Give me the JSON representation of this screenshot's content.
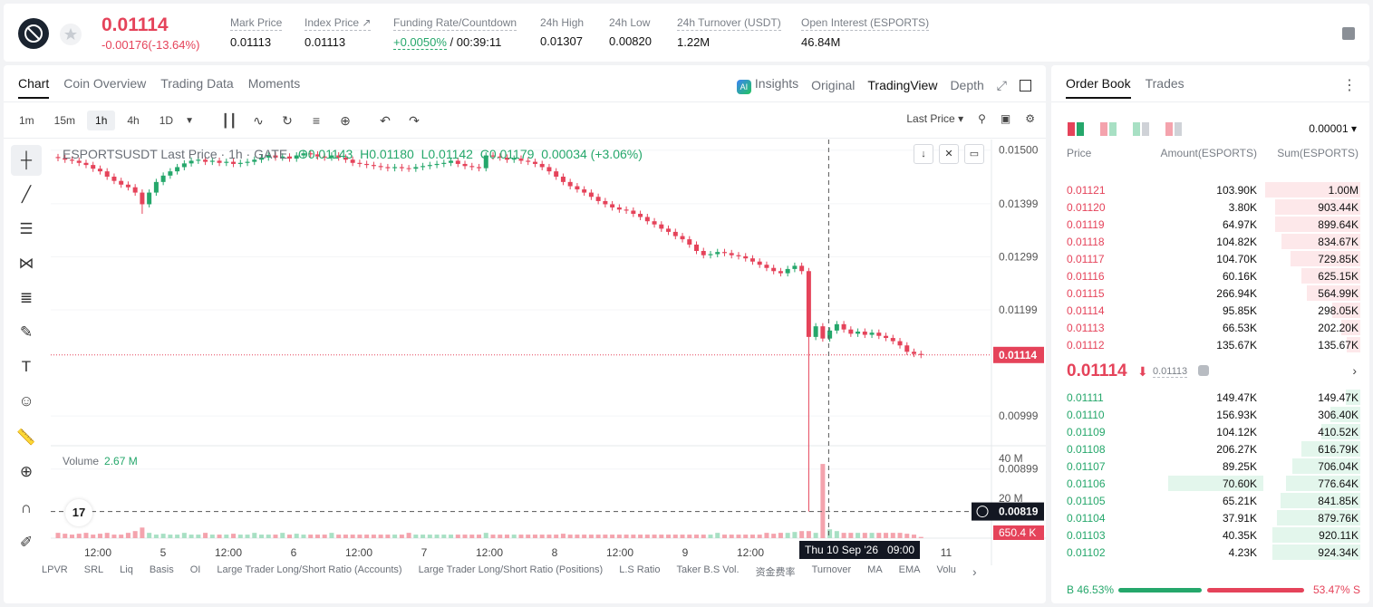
{
  "ticker": {
    "last_price": "0.01114",
    "change": "-0.00176(-13.64%)",
    "stats": [
      {
        "label": "Mark Price",
        "value": "0.01113"
      },
      {
        "label": "Index Price ↗",
        "value": "0.01113"
      },
      {
        "label": "Funding Rate/Countdown",
        "value_pos": "+0.0050%",
        "value": " / 00:39:11"
      },
      {
        "label": "24h High",
        "value": "0.01307"
      },
      {
        "label": "24h Low",
        "value": "0.00820"
      },
      {
        "label": "24h Turnover (USDT)",
        "value": "1.22M"
      },
      {
        "label": "Open Interest (ESPORTS)",
        "value": "46.84M"
      }
    ]
  },
  "chart_tabs": [
    "Chart",
    "Coin Overview",
    "Trading Data",
    "Moments"
  ],
  "view_switch": {
    "insights": "Insights",
    "original": "Original",
    "tradingview": "TradingView",
    "depth": "Depth"
  },
  "intervals": [
    "1m",
    "15m",
    "1h",
    "4h",
    "1D"
  ],
  "price_type": "Last Price",
  "legend": {
    "symbol": "ESPORTSUSDT Last Price · 1h · GATE",
    "o": "O0.01143",
    "h": "H0.01180",
    "l": "L0.01142",
    "c": "C0.01179",
    "chg": "0.00034 (+3.06%)"
  },
  "volume": {
    "label": "Volume",
    "value": "2.67 M"
  },
  "crosshair": {
    "date": "Thu 10 Sep '26",
    "time": "09:00"
  },
  "indicators": [
    "LPVR",
    "SRL",
    "Liq",
    "Basis",
    "OI",
    "Large Trader Long/Short Ratio (Accounts)",
    "Large Trader Long/Short Ratio (Positions)",
    "L.S Ratio",
    "Taker B.S Vol.",
    "资金费率",
    "Turnover",
    "MA",
    "EMA",
    "Volu"
  ],
  "chart_data": {
    "type": "candlestick",
    "y_ticks": [
      "0.01500",
      "0.01399",
      "0.01299",
      "0.01199",
      "0.00999",
      "0.00899"
    ],
    "ylim": [
      0.0082,
      0.0152
    ],
    "current_price": "0.01114",
    "low_marker": "0.00819",
    "volume_ticks": [
      "40 M",
      "20 M"
    ],
    "volume_current": "650.4 K",
    "x_ticks": [
      "12:00",
      "5",
      "12:00",
      "6",
      "12:00",
      "7",
      "12:00",
      "8",
      "12:00",
      "9",
      "12:00",
      "11"
    ],
    "closes": [
      0.01485,
      0.01482,
      0.0148,
      0.01476,
      0.01472,
      0.01465,
      0.0146,
      0.0145,
      0.01442,
      0.01435,
      0.0143,
      0.0142,
      0.01398,
      0.0142,
      0.0144,
      0.01452,
      0.0146,
      0.01468,
      0.01475,
      0.0148,
      0.01482,
      0.01478,
      0.0148,
      0.01476,
      0.01478,
      0.01474,
      0.01476,
      0.01478,
      0.01482,
      0.01486,
      0.0149,
      0.01486,
      0.01488,
      0.01484,
      0.0149,
      0.01494,
      0.01492,
      0.01488,
      0.01486,
      0.0149,
      0.01486,
      0.01482,
      0.01476,
      0.01474,
      0.01472,
      0.0147,
      0.01468,
      0.01466,
      0.01468,
      0.01466,
      0.01465,
      0.01468,
      0.0147,
      0.01472,
      0.01474,
      0.01476,
      0.0148,
      0.01474,
      0.0147,
      0.01468,
      0.01466,
      0.0149,
      0.01488,
      0.01486,
      0.01482,
      0.01484,
      0.0148,
      0.01478,
      0.01474,
      0.01468,
      0.0146,
      0.0145,
      0.0144,
      0.01432,
      0.01426,
      0.0142,
      0.01412,
      0.01404,
      0.01398,
      0.01392,
      0.01388,
      0.01386,
      0.0138,
      0.01374,
      0.01366,
      0.0136,
      0.01352,
      0.01346,
      0.01338,
      0.01332,
      0.01322,
      0.0131,
      0.01302,
      0.01304,
      0.01308,
      0.01306,
      0.01302,
      0.013,
      0.01296,
      0.0129,
      0.01284,
      0.01278,
      0.01272,
      0.01268,
      0.01276,
      0.01282,
      0.01272,
      0.01148,
      0.01168,
      0.01145,
      0.0116,
      0.01172,
      0.01162,
      0.01154,
      0.01158,
      0.01152,
      0.01156,
      0.0115,
      0.01146,
      0.0114,
      0.01132,
      0.0112,
      0.01116,
      0.01114
    ],
    "volumes": [
      3,
      2.5,
      2,
      2.5,
      3,
      2,
      2.5,
      3,
      2,
      2,
      3,
      4,
      6,
      3,
      2,
      2.5,
      2,
      2,
      3,
      2,
      2,
      3,
      2,
      2,
      2,
      2.5,
      2,
      2,
      3,
      2,
      2,
      2,
      3,
      2,
      2.5,
      2,
      2,
      2,
      2,
      3,
      2,
      2,
      2,
      2,
      2,
      2,
      2,
      2,
      2,
      2,
      3,
      2,
      2,
      2,
      2,
      2,
      2,
      2,
      2,
      2,
      2,
      3,
      2,
      2,
      2,
      2,
      2,
      2,
      2,
      2,
      2,
      2,
      2.5,
      2,
      2,
      2,
      2,
      2,
      2,
      2,
      2,
      2,
      2,
      2,
      2,
      2,
      2,
      2,
      2,
      2,
      2,
      2,
      2,
      2,
      3,
      2,
      2,
      2,
      2,
      2,
      2,
      3,
      2.5,
      3,
      3,
      3.5,
      4,
      4,
      3,
      42,
      5,
      4,
      3,
      3,
      3,
      3,
      3,
      3,
      3,
      3,
      3,
      2.5,
      2,
      0.7
    ],
    "low_index": 107,
    "low_value": 0.00819
  },
  "orderbook": {
    "tabs": [
      "Order Book",
      "Trades"
    ],
    "precision": "0.00001",
    "headers": {
      "price": "Price",
      "amount": "Amount(ESPORTS)",
      "sum": "Sum(ESPORTS)"
    },
    "asks": [
      {
        "price": "0.01121",
        "amount": "103.90K",
        "sum": "1.00M",
        "depth": 1.0
      },
      {
        "price": "0.01120",
        "amount": "3.80K",
        "sum": "903.44K",
        "depth": 0.9
      },
      {
        "price": "0.01119",
        "amount": "64.97K",
        "sum": "899.64K",
        "depth": 0.9
      },
      {
        "price": "0.01118",
        "amount": "104.82K",
        "sum": "834.67K",
        "depth": 0.83
      },
      {
        "price": "0.01117",
        "amount": "104.70K",
        "sum": "729.85K",
        "depth": 0.73
      },
      {
        "price": "0.01116",
        "amount": "60.16K",
        "sum": "625.15K",
        "depth": 0.62
      },
      {
        "price": "0.01115",
        "amount": "266.94K",
        "sum": "564.99K",
        "depth": 0.56
      },
      {
        "price": "0.01114",
        "amount": "95.85K",
        "sum": "298.05K",
        "depth": 0.3
      },
      {
        "price": "0.01113",
        "amount": "66.53K",
        "sum": "202.20K",
        "depth": 0.2
      },
      {
        "price": "0.01112",
        "amount": "135.67K",
        "sum": "135.67K",
        "depth": 0.14
      }
    ],
    "mid_price": "0.01114",
    "mark_price": "0.01113",
    "bids": [
      {
        "price": "0.01111",
        "amount": "149.47K",
        "sum": "149.47K",
        "depth": 0.15
      },
      {
        "price": "0.01110",
        "amount": "156.93K",
        "sum": "306.40K",
        "depth": 0.31
      },
      {
        "price": "0.01109",
        "amount": "104.12K",
        "sum": "410.52K",
        "depth": 0.41
      },
      {
        "price": "0.01108",
        "amount": "206.27K",
        "sum": "616.79K",
        "depth": 0.62
      },
      {
        "price": "0.01107",
        "amount": "89.25K",
        "sum": "706.04K",
        "depth": 0.71
      },
      {
        "price": "0.01106",
        "amount": "70.60K",
        "sum": "776.64K",
        "depth": 0.78
      },
      {
        "price": "0.01105",
        "amount": "65.21K",
        "sum": "841.85K",
        "depth": 0.84
      },
      {
        "price": "0.01104",
        "amount": "37.91K",
        "sum": "879.76K",
        "depth": 0.88
      },
      {
        "price": "0.01103",
        "amount": "40.35K",
        "sum": "920.11K",
        "depth": 0.92
      },
      {
        "price": "0.01102",
        "amount": "4.23K",
        "sum": "924.34K",
        "depth": 0.92
      }
    ],
    "buy_ratio": "B 46.53%",
    "sell_ratio": "53.47% S",
    "buy_fraction": 0.4653
  }
}
